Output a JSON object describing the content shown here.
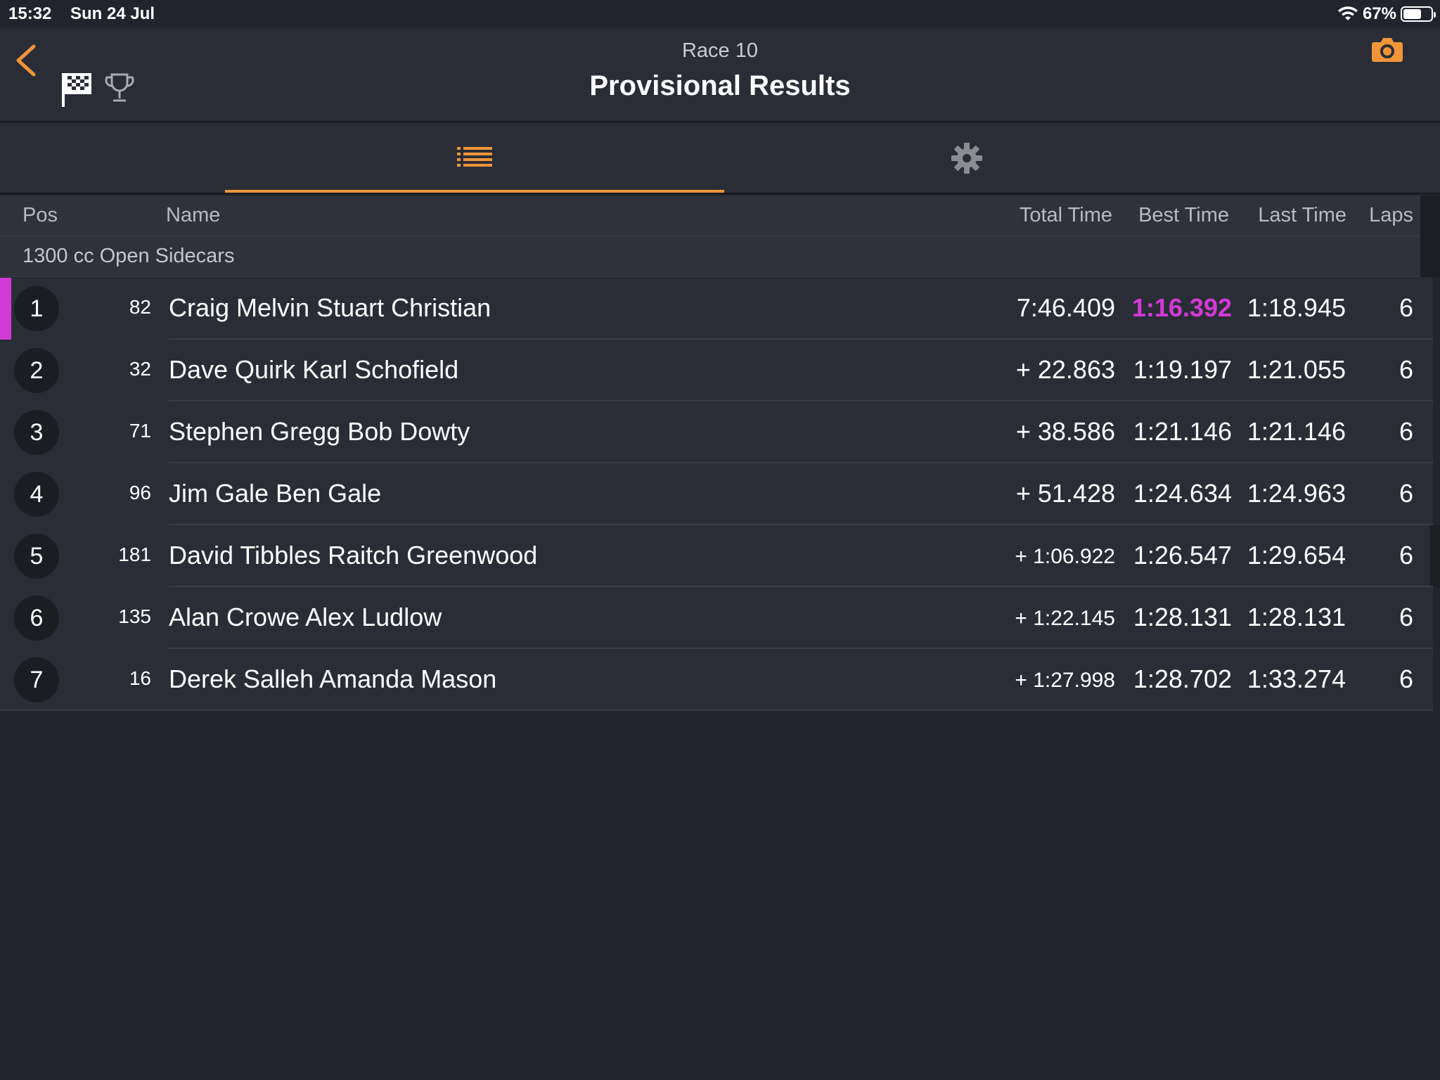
{
  "status": {
    "time": "15:32",
    "date": "Sun 24 Jul",
    "battery": "67%",
    "battery_level": 0.67
  },
  "header": {
    "race": "Race 10",
    "title": "Provisional Results"
  },
  "table": {
    "headers": {
      "pos": "Pos",
      "name": "Name",
      "total": "Total Time",
      "best": "Best Time",
      "last": "Last Time",
      "laps": "Laps"
    },
    "class_name": "1300 cc Open Sidecars",
    "rows": [
      {
        "pos": "1",
        "num": "82",
        "name": "Craig Melvin Stuart Christian",
        "total": "7:46.409",
        "best": "1:16.392",
        "last": "1:18.945",
        "laps": "6"
      },
      {
        "pos": "2",
        "num": "32",
        "name": "Dave Quirk Karl Schofield",
        "total": "+ 22.863",
        "best": "1:19.197",
        "last": "1:21.055",
        "laps": "6"
      },
      {
        "pos": "3",
        "num": "71",
        "name": "Stephen Gregg Bob Dowty",
        "total": "+ 38.586",
        "best": "1:21.146",
        "last": "1:21.146",
        "laps": "6"
      },
      {
        "pos": "4",
        "num": "96",
        "name": "Jim Gale Ben Gale",
        "total": "+ 51.428",
        "best": "1:24.634",
        "last": "1:24.963",
        "laps": "6"
      },
      {
        "pos": "5",
        "num": "181",
        "name": "David Tibbles Raitch Greenwood",
        "total": "+ 1:06.922",
        "best": "1:26.547",
        "last": "1:29.654",
        "laps": "6"
      },
      {
        "pos": "6",
        "num": "135",
        "name": "Alan Crowe Alex Ludlow",
        "total": "+ 1:22.145",
        "best": "1:28.131",
        "last": "1:28.131",
        "laps": "6"
      },
      {
        "pos": "7",
        "num": "16",
        "name": "Derek Salleh Amanda Mason",
        "total": "+ 1:27.998",
        "best": "1:28.702",
        "last": "1:33.274",
        "laps": "6"
      }
    ]
  },
  "colors": {
    "accent": "#f0953a",
    "fastest": "#d23ad6",
    "background": "#21242d"
  },
  "icons": {
    "back": "chevron-left-icon",
    "flag": "checkered-flag-icon",
    "trophy": "trophy-icon",
    "camera": "camera-icon",
    "list": "list-icon",
    "settings": "gear-icon"
  }
}
